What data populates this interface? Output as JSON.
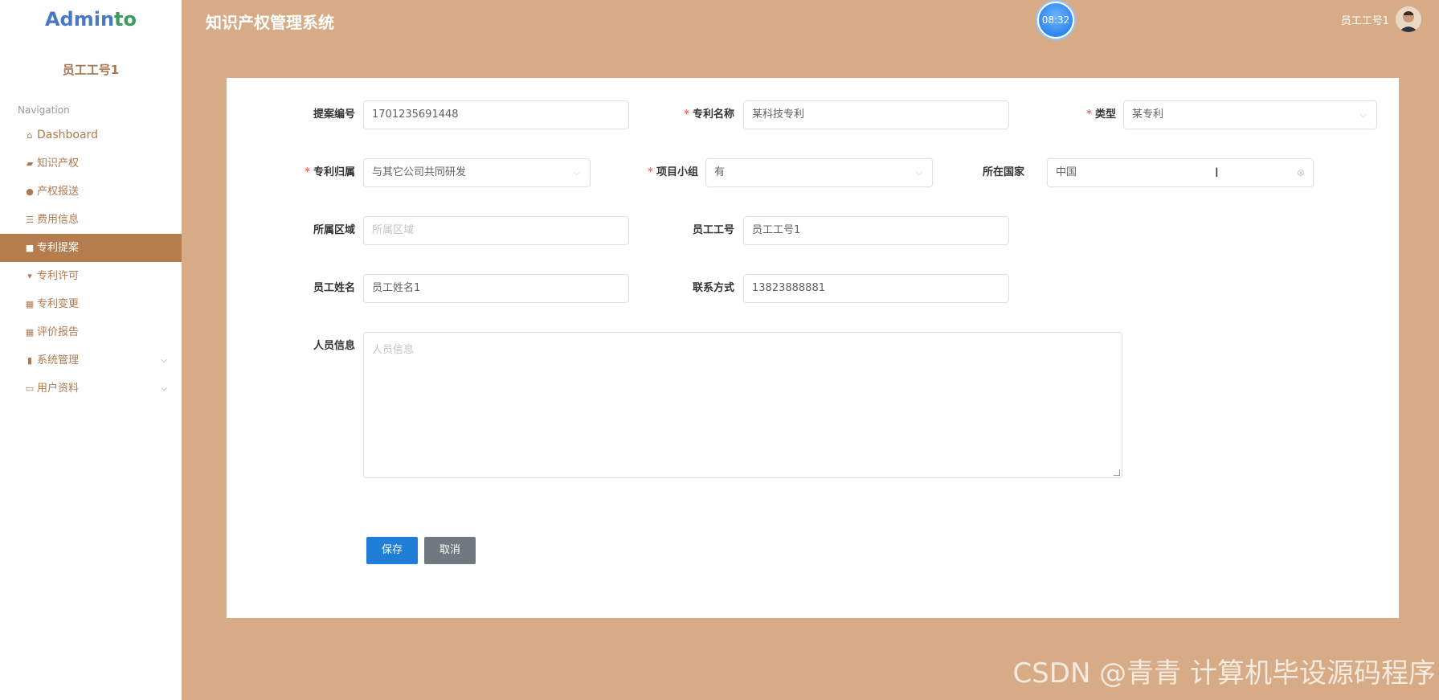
{
  "sidebar": {
    "logo_part1": "Admin",
    "logo_part2": "to",
    "user": "员工工号1",
    "nav_title": "Navigation",
    "items": [
      {
        "label": "Dashboard",
        "icon": "home-icon"
      },
      {
        "label": "知识产权",
        "icon": "ticket-icon"
      },
      {
        "label": "产权报送",
        "icon": "user-icon"
      },
      {
        "label": "费用信息",
        "icon": "sliders-icon"
      },
      {
        "label": "专利提案",
        "icon": "thumbs-up-icon"
      },
      {
        "label": "专利许可",
        "icon": "stamp-icon"
      },
      {
        "label": "专利变更",
        "icon": "grid-icon"
      },
      {
        "label": "评价报告",
        "icon": "grid-icon"
      },
      {
        "label": "系统管理",
        "icon": "chart-icon"
      },
      {
        "label": "用户资料",
        "icon": "card-icon"
      }
    ]
  },
  "header": {
    "title": "知识产权管理系统",
    "clock": "08:32",
    "user": "员工工号1"
  },
  "form": {
    "proposal_no": {
      "label": "提案编号",
      "value": "1701235691448"
    },
    "patent_name": {
      "label": "专利名称",
      "value": "某科技专利"
    },
    "type": {
      "label": "类型",
      "value": "某专利"
    },
    "ownership": {
      "label": "专利归属",
      "value": "与其它公司共同研发"
    },
    "project_group": {
      "label": "项目小组",
      "value": "有"
    },
    "country": {
      "label": "所在国家",
      "value": "中国"
    },
    "region": {
      "label": "所属区域",
      "placeholder": "所属区域"
    },
    "employee_no": {
      "label": "员工工号",
      "value": "员工工号1"
    },
    "employee_name": {
      "label": "员工姓名",
      "value": "员工姓名1"
    },
    "contact": {
      "label": "联系方式",
      "value": "13823888881"
    },
    "personnel": {
      "label": "人员信息",
      "placeholder": "人员信息"
    },
    "save_label": "保存",
    "cancel_label": "取消"
  },
  "watermark": "CSDN @青青 计算机毕设源码程序"
}
